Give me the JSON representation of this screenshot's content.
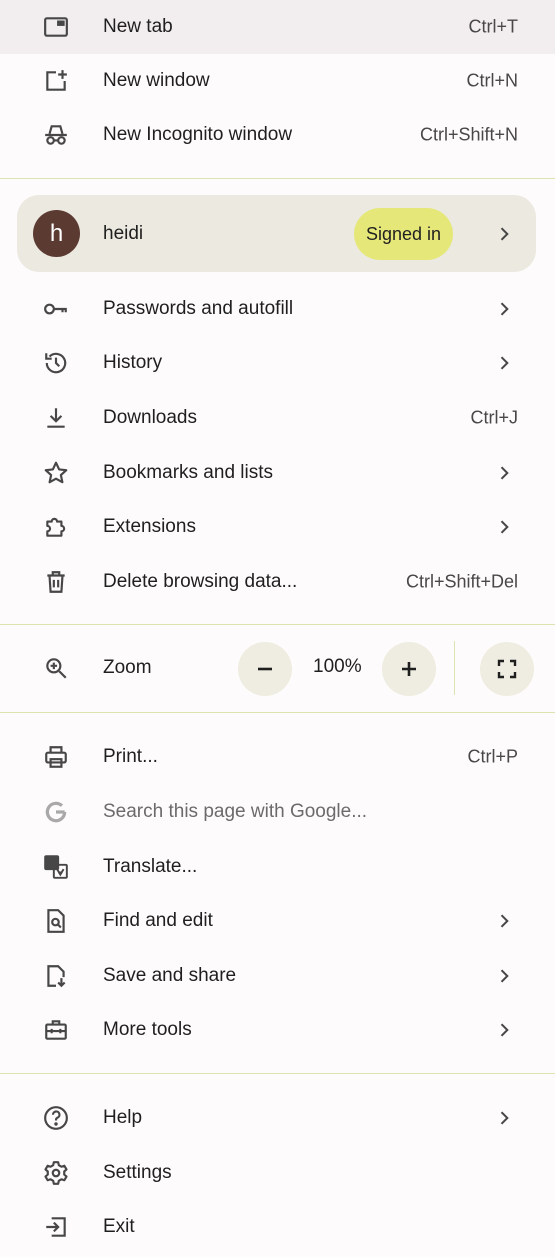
{
  "menu": {
    "group1": [
      {
        "label": "New tab",
        "shortcut": "Ctrl+T",
        "icon": "tab-icon"
      },
      {
        "label": "New window",
        "shortcut": "Ctrl+N",
        "icon": "new-window-icon"
      },
      {
        "label": "New Incognito window",
        "shortcut": "Ctrl+Shift+N",
        "icon": "incognito-icon"
      }
    ],
    "profile": {
      "initial": "h",
      "name": "heidi",
      "status": "Signed in",
      "avatar_color": "#5b3a32",
      "badge_color": "#e5e879"
    },
    "group2": [
      {
        "label": "Passwords and autofill",
        "icon": "key-icon"
      },
      {
        "label": "History",
        "icon": "history-icon"
      },
      {
        "label": "Downloads",
        "shortcut": "Ctrl+J",
        "icon": "download-icon"
      },
      {
        "label": "Bookmarks and lists",
        "icon": "star-icon"
      },
      {
        "label": "Extensions",
        "icon": "puzzle-icon"
      },
      {
        "label": "Delete browsing data...",
        "shortcut": "Ctrl+Shift+Del",
        "icon": "trash-icon"
      }
    ],
    "zoom": {
      "label": "Zoom",
      "value": "100%"
    },
    "group3": [
      {
        "label": "Print...",
        "shortcut": "Ctrl+P",
        "icon": "printer-icon"
      },
      {
        "label": "Search this page with Google...",
        "icon": "google-icon"
      },
      {
        "label": "Translate...",
        "icon": "translate-icon"
      },
      {
        "label": "Find and edit",
        "icon": "find-icon"
      },
      {
        "label": "Save and share",
        "icon": "save-icon"
      },
      {
        "label": "More tools",
        "icon": "toolbox-icon"
      }
    ],
    "group4": [
      {
        "label": "Help",
        "icon": "help-icon"
      },
      {
        "label": "Settings",
        "icon": "gear-icon"
      },
      {
        "label": "Exit",
        "icon": "exit-icon"
      }
    ]
  },
  "colors": {
    "background": "#fefbfc",
    "highlight": "#f2eef0",
    "divider": "#dfe3b0",
    "icon": "#474747"
  }
}
